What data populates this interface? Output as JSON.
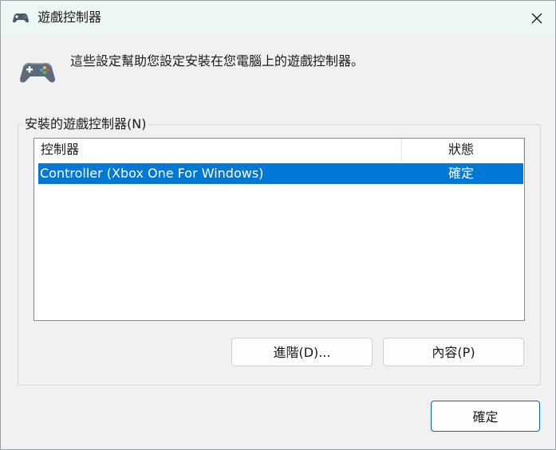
{
  "window": {
    "title": "遊戲控制器",
    "icon": "gamepad-icon",
    "close_icon": "close-icon"
  },
  "description": "這些設定幫助您設定安裝在您電腦上的遊戲控制器。",
  "group": {
    "label": "安裝的遊戲控制器(N)"
  },
  "list": {
    "columns": [
      "控制器",
      "狀態"
    ],
    "rows": [
      {
        "controller": "Controller (Xbox One For Windows)",
        "status": "確定",
        "selected": true
      }
    ]
  },
  "buttons": {
    "advanced": "進階(D)...",
    "properties": "內容(P)",
    "ok": "確定"
  },
  "colors": {
    "titlebar": "#eef6f3",
    "selection": "#0078d7",
    "accent_border": "#0067c0"
  }
}
